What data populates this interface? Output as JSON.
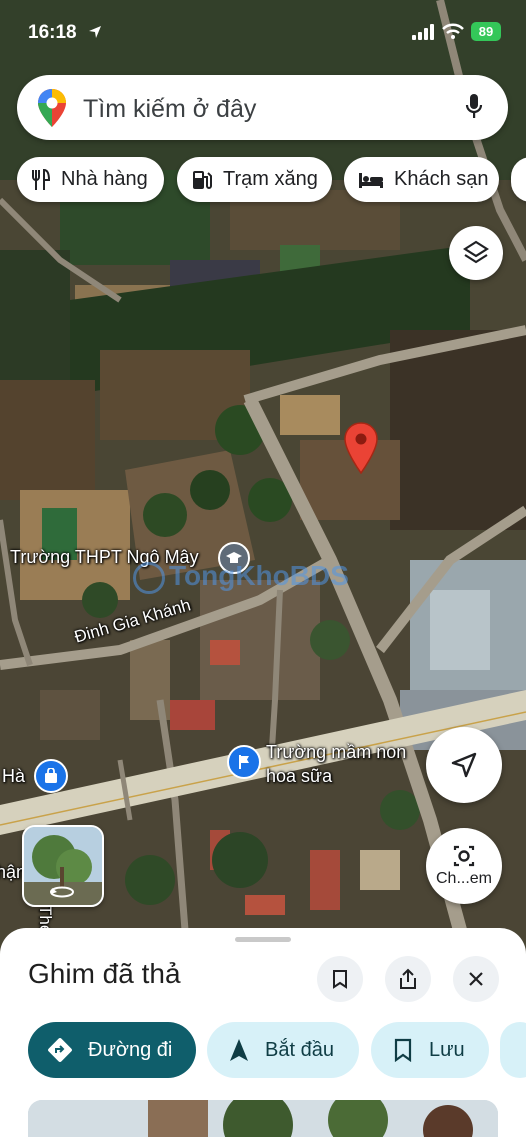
{
  "status_bar": {
    "time": "16:18",
    "battery": "89"
  },
  "search": {
    "placeholder": "Tìm kiếm ở đây"
  },
  "chips": [
    {
      "label": "Nhà hàng",
      "icon": "restaurant-icon"
    },
    {
      "label": "Trạm xăng",
      "icon": "gas-station-icon"
    },
    {
      "label": "Khách sạn",
      "icon": "hotel-icon"
    }
  ],
  "map_labels": {
    "school": "Trường THPT Ngô Mây",
    "street": "Đinh Gia Khánh",
    "kindergarten_line1": "Trường mầm non",
    "kindergarten_line2": "hoa sữa",
    "left_place": "Hà",
    "left_edge_1": "hận",
    "left_edge_2": "The",
    "watermark": "TongKhoBDS"
  },
  "street_view_button": {
    "label": "Ch...em"
  },
  "sheet": {
    "title": "Ghim đã thả",
    "actions": [
      {
        "label": "Đường đi",
        "primary": true
      },
      {
        "label": "Bắt đầu",
        "primary": false
      },
      {
        "label": "Lưu",
        "primary": false
      }
    ]
  },
  "colors": {
    "primary": "#0b57d0",
    "directions_bg": "#0f5e6b",
    "action_bg": "#d7f1f8",
    "pin": "#ea4335",
    "battery": "#34c759"
  }
}
